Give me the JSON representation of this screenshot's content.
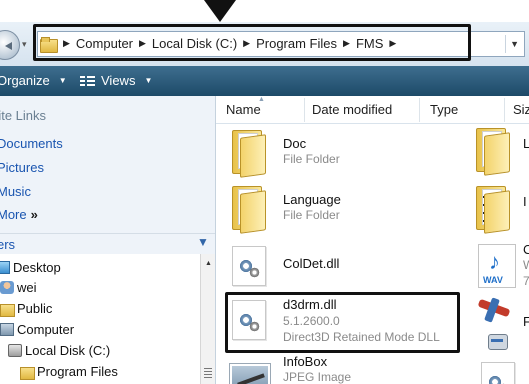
{
  "address": {
    "crumbs": [
      "Computer",
      "Local Disk (C:)",
      "Program Files",
      "FMS"
    ]
  },
  "toolbar": {
    "organize_label": "Organize",
    "views_label": "Views"
  },
  "navpane": {
    "heading": "rite Links",
    "links": [
      "Documents",
      "Pictures",
      "Music"
    ],
    "more_label": "More",
    "more_glyph": "»",
    "folders_label": "ers",
    "tree": [
      "Desktop",
      "wei",
      "Public",
      "Computer",
      "Local Disk (C:)",
      "Program Files"
    ]
  },
  "columns": {
    "name": "Name",
    "date": "Date modified",
    "type": "Type",
    "size": "Siz"
  },
  "files": [
    {
      "name": "Doc",
      "subtitle": "File Folder"
    },
    {
      "name": "Language",
      "subtitle": "File Folder"
    },
    {
      "name": "ColDet.dll",
      "subtitle": ""
    },
    {
      "name": "d3drm.dll",
      "subtitle": "5.1.2600.0",
      "description": "Direct3D Retained Mode DLL"
    },
    {
      "name": "InfoBox",
      "subtitle": "JPEG Image"
    }
  ],
  "right_column": {
    "labels": [
      "L",
      "I",
      "C",
      "W",
      "7",
      "F",
      ""
    ]
  }
}
